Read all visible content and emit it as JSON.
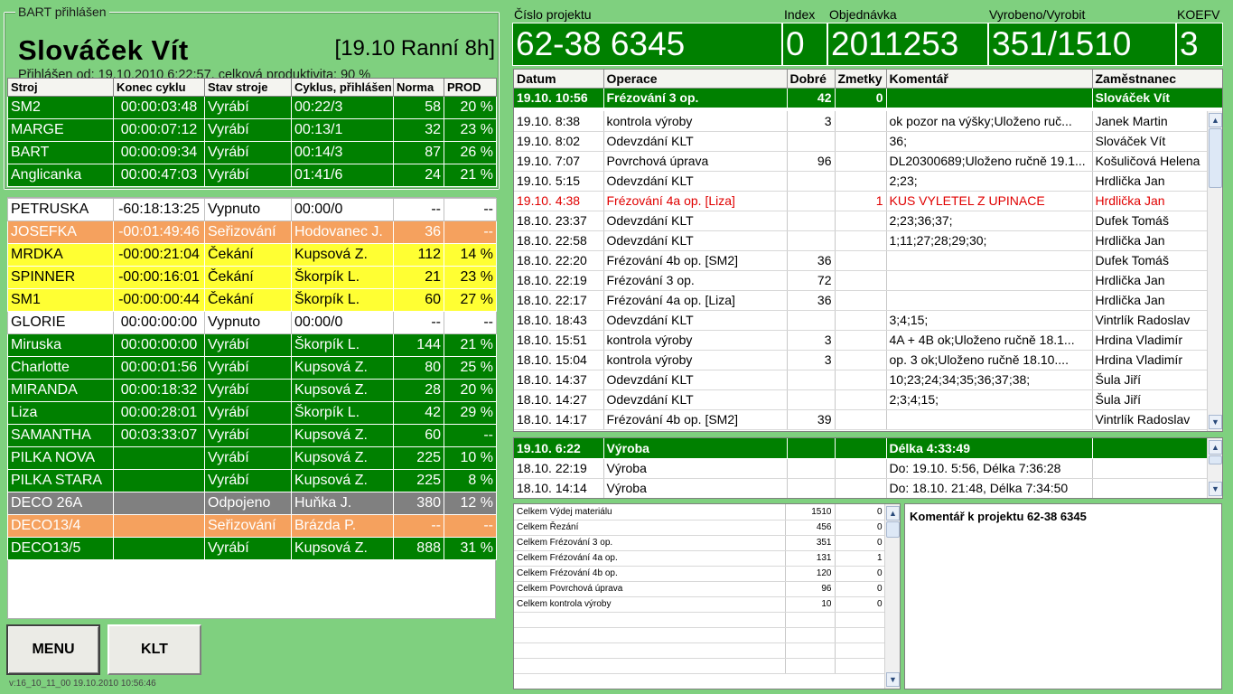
{
  "login": {
    "legend": "BART přihlášen",
    "user": "Slováček Vít",
    "shift": "[19.10 Ranní 8h]",
    "since": "Přihlášen od: 19.10.2010 6:22:57, celková produktivita: 90 %"
  },
  "machine_columns": [
    "Stroj",
    "Konec cyklu",
    "Stav stroje",
    "Cyklus, přihlášen",
    "Norma",
    "PROD"
  ],
  "top_machines": [
    {
      "stroj": "SM2",
      "konec": "00:00:03:48",
      "stav": "Vyrábí",
      "cyklus": "00:22/3",
      "norma": "58",
      "prod": "20 %",
      "status": "green"
    },
    {
      "stroj": "MARGE",
      "konec": "00:00:07:12",
      "stav": "Vyrábí",
      "cyklus": "00:13/1",
      "norma": "32",
      "prod": "23 %",
      "status": "green"
    },
    {
      "stroj": "BART",
      "konec": "00:00:09:34",
      "stav": "Vyrábí",
      "cyklus": "00:14/3",
      "norma": "87",
      "prod": "26 %",
      "status": "green"
    },
    {
      "stroj": "Anglicanka",
      "konec": "00:00:47:03",
      "stav": "Vyrábí",
      "cyklus": "01:41/6",
      "norma": "24",
      "prod": "21 %",
      "status": "green"
    }
  ],
  "other_machines": [
    {
      "stroj": "PETRUSKA",
      "konec": "-60:18:13:25",
      "stav": "Vypnuto",
      "cyklus": "00:00/0",
      "norma": "--",
      "prod": "--",
      "status": "white"
    },
    {
      "stroj": "JOSEFKA",
      "konec": "-00:01:49:46",
      "stav": "Seřizování",
      "cyklus": "Hodovanec J.",
      "norma": "36",
      "prod": "--",
      "status": "orange"
    },
    {
      "stroj": "MRDKA",
      "konec": "-00:00:21:04",
      "stav": "Čekání",
      "cyklus": "Kupsová Z.",
      "norma": "112",
      "prod": "14 %",
      "status": "yellow"
    },
    {
      "stroj": "SPINNER",
      "konec": "-00:00:16:01",
      "stav": "Čekání",
      "cyklus": "Škorpík L.",
      "norma": "21",
      "prod": "23 %",
      "status": "yellow"
    },
    {
      "stroj": "SM1",
      "konec": "-00:00:00:44",
      "stav": "Čekání",
      "cyklus": "Škorpík L.",
      "norma": "60",
      "prod": "27 %",
      "status": "yellow"
    },
    {
      "stroj": "GLORIE",
      "konec": "00:00:00:00",
      "stav": "Vypnuto",
      "cyklus": "00:00/0",
      "norma": "--",
      "prod": "--",
      "status": "white"
    },
    {
      "stroj": "Miruska",
      "konec": "00:00:00:00",
      "stav": "Vyrábí",
      "cyklus": "Škorpík L.",
      "norma": "144",
      "prod": "21 %",
      "status": "green"
    },
    {
      "stroj": "Charlotte",
      "konec": "00:00:01:56",
      "stav": "Vyrábí",
      "cyklus": "Kupsová Z.",
      "norma": "80",
      "prod": "25 %",
      "status": "green"
    },
    {
      "stroj": "MIRANDA",
      "konec": "00:00:18:32",
      "stav": "Vyrábí",
      "cyklus": "Kupsová Z.",
      "norma": "28",
      "prod": "20 %",
      "status": "green"
    },
    {
      "stroj": "Liza",
      "konec": "00:00:28:01",
      "stav": "Vyrábí",
      "cyklus": "Škorpík L.",
      "norma": "42",
      "prod": "29 %",
      "status": "green"
    },
    {
      "stroj": "SAMANTHA",
      "konec": "00:03:33:07",
      "stav": "Vyrábí",
      "cyklus": "Kupsová Z.",
      "norma": "60",
      "prod": "--",
      "status": "green"
    },
    {
      "stroj": "PILKA NOVA",
      "konec": "",
      "stav": "Vyrábí",
      "cyklus": "Kupsová Z.",
      "norma": "225",
      "prod": "10 %",
      "status": "green"
    },
    {
      "stroj": "PILKA STARA",
      "konec": "",
      "stav": "Vyrábí",
      "cyklus": "Kupsová Z.",
      "norma": "225",
      "prod": "8 %",
      "status": "green"
    },
    {
      "stroj": "DECO 26A",
      "konec": "",
      "stav": "Odpojeno",
      "cyklus": "Huňka J.",
      "norma": "380",
      "prod": "12 %",
      "status": "gray"
    },
    {
      "stroj": "DECO13/4",
      "konec": "",
      "stav": "Seřizování",
      "cyklus": "Brázda P.",
      "norma": "--",
      "prod": "--",
      "status": "orange"
    },
    {
      "stroj": "DECO13/5",
      "konec": "",
      "stav": "Vyrábí",
      "cyklus": "Kupsová Z.",
      "norma": "888",
      "prod": "31 %",
      "status": "green"
    }
  ],
  "buttons": {
    "menu": "MENU",
    "klt": "KLT"
  },
  "version": "v:16_10_11_00  19.10.2010 10:56:46",
  "project": {
    "labels": {
      "cislo": "Číslo projektu",
      "index": "Index",
      "objednavka": "Objednávka",
      "vyrobeno": "Vyrobeno/Vyrobit",
      "koefv": "KOEFV"
    },
    "cislo": "62-38 6345",
    "index": "0",
    "objednavka": "2011253",
    "vyrobeno": "351/1510",
    "koefv": "3"
  },
  "ops_columns": [
    "Datum",
    "Operace",
    "Dobré",
    "Zmetky",
    "Komentář",
    "Zaměstnanec"
  ],
  "ops_selected": {
    "datum": "19.10. 10:56",
    "operace": "Frézování 3 op.",
    "dobre": "42",
    "zmetky": "0",
    "komentar": "",
    "zamestnanec": "Slováček Vít"
  },
  "ops_rows": [
    {
      "datum": "19.10. 8:38",
      "operace": "kontrola výroby",
      "dobre": "3",
      "zmetky": "",
      "komentar": "ok pozor na výšky;Uloženo ruč...",
      "zamestnanec": "Janek Martin"
    },
    {
      "datum": "19.10. 8:02",
      "operace": "Odevzdání KLT",
      "dobre": "",
      "zmetky": "",
      "komentar": "36;",
      "zamestnanec": "Slováček Vít"
    },
    {
      "datum": "19.10. 7:07",
      "operace": "Povrchová úprava",
      "dobre": "96",
      "zmetky": "",
      "komentar": "DL20300689;Uloženo ručně 19.1...",
      "zamestnanec": "Košuličová Helena"
    },
    {
      "datum": "19.10. 5:15",
      "operace": "Odevzdání KLT",
      "dobre": "",
      "zmetky": "",
      "komentar": "2;23;",
      "zamestnanec": "Hrdlička Jan"
    },
    {
      "datum": "19.10. 4:38",
      "operace": "Frézování 4a op. [Liza]",
      "dobre": "",
      "zmetky": "1",
      "komentar": "KUS VYLETEL Z UPINACE",
      "zamestnanec": "Hrdlička Jan",
      "red": true
    },
    {
      "datum": "18.10. 23:37",
      "operace": "Odevzdání KLT",
      "dobre": "",
      "zmetky": "",
      "komentar": "2;23;36;37;",
      "zamestnanec": "Dufek Tomáš"
    },
    {
      "datum": "18.10. 22:58",
      "operace": "Odevzdání KLT",
      "dobre": "",
      "zmetky": "",
      "komentar": "1;11;27;28;29;30;",
      "zamestnanec": "Hrdlička Jan"
    },
    {
      "datum": "18.10. 22:20",
      "operace": "Frézování 4b op. [SM2]",
      "dobre": "36",
      "zmetky": "",
      "komentar": "",
      "zamestnanec": "Dufek Tomáš"
    },
    {
      "datum": "18.10. 22:19",
      "operace": "Frézování 3 op.",
      "dobre": "72",
      "zmetky": "",
      "komentar": "",
      "zamestnanec": "Hrdlička Jan"
    },
    {
      "datum": "18.10. 22:17",
      "operace": "Frézování 4a op. [Liza]",
      "dobre": "36",
      "zmetky": "",
      "komentar": "",
      "zamestnanec": "Hrdlička Jan"
    },
    {
      "datum": "18.10. 18:43",
      "operace": "Odevzdání KLT",
      "dobre": "",
      "zmetky": "",
      "komentar": "3;4;15;",
      "zamestnanec": "Vintrlík Radoslav"
    },
    {
      "datum": "18.10. 15:51",
      "operace": "kontrola výroby",
      "dobre": "3",
      "zmetky": "",
      "komentar": "4A + 4B ok;Uloženo ručně 18.1...",
      "zamestnanec": "Hrdina Vladimír"
    },
    {
      "datum": "18.10. 15:04",
      "operace": "kontrola výroby",
      "dobre": "3",
      "zmetky": "",
      "komentar": "op. 3 ok;Uloženo ručně 18.10....",
      "zamestnanec": "Hrdina Vladimír"
    },
    {
      "datum": "18.10. 14:37",
      "operace": "Odevzdání KLT",
      "dobre": "",
      "zmetky": "",
      "komentar": "10;23;24;34;35;36;37;38;",
      "zamestnanec": "Šula Jiří"
    },
    {
      "datum": "18.10. 14:27",
      "operace": "Odevzdání KLT",
      "dobre": "",
      "zmetky": "",
      "komentar": "2;3;4;15;",
      "zamestnanec": "Šula Jiří"
    },
    {
      "datum": "18.10. 14:17",
      "operace": "Frézování 4b op. [SM2]",
      "dobre": "39",
      "zmetky": "",
      "komentar": "",
      "zamestnanec": "Vintrlík Radoslav"
    }
  ],
  "production_rows": [
    {
      "datum": "19.10. 6:22",
      "operace": "Výroba",
      "komentar": "Délka 4:33:49",
      "selected": true
    },
    {
      "datum": "18.10. 22:19",
      "operace": "Výroba",
      "komentar": "Do: 19.10. 5:56, Délka 7:36:28"
    },
    {
      "datum": "18.10. 14:14",
      "operace": "Výroba",
      "komentar": "Do: 18.10. 21:48, Délka 7:34:50"
    }
  ],
  "totals": [
    {
      "label": "Celkem Výdej materiálu",
      "a": "1510",
      "b": "0"
    },
    {
      "label": "Celkem Řezání",
      "a": "456",
      "b": "0"
    },
    {
      "label": "Celkem Frézování 3 op.",
      "a": "351",
      "b": "0"
    },
    {
      "label": "Celkem Frézování 4a op.",
      "a": "131",
      "b": "1"
    },
    {
      "label": "Celkem Frézování 4b op.",
      "a": "120",
      "b": "0"
    },
    {
      "label": "Celkem Povrchová úprava",
      "a": "96",
      "b": "0"
    },
    {
      "label": "Celkem kontrola výroby",
      "a": "10",
      "b": "0"
    }
  ],
  "project_comment": "Komentář k projektu 62-38 6345",
  "colors": {
    "panel_bg": "#7fd07f",
    "green": "#008000",
    "yellow": "#ffff33",
    "orange": "#f5a15e",
    "gray": "#808080",
    "error_red": "#e00000"
  }
}
